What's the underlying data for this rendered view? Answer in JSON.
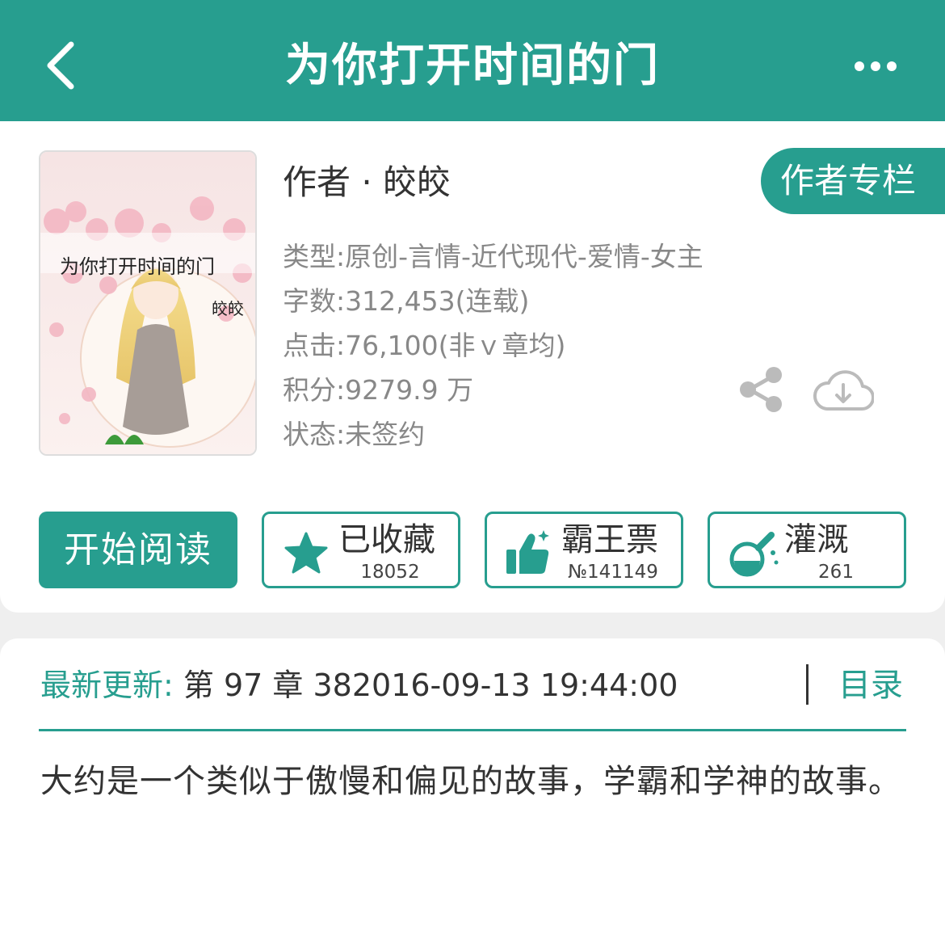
{
  "header": {
    "title": "为你打开时间的门",
    "back_icon": "chevron-left-icon",
    "more_icon": "more-horizontal-icon",
    "bg_color": "#279e8f"
  },
  "book": {
    "cover": {
      "title": "为你打开时间的门",
      "author": "皎皎"
    },
    "author_line": "作者 · 皎皎",
    "author_column_label": "作者专栏",
    "meta": {
      "type": "类型:原创-言情-近代现代-爱情-女主",
      "words": "字数:312,453(连载)",
      "clicks": "点击:76,100(非ｖ章均)",
      "score": "积分:9279.9 万",
      "status": "状态:未签约"
    },
    "share_icon": "share-icon",
    "download_icon": "cloud-download-icon"
  },
  "actions": {
    "start_reading": "开始阅读",
    "collect": {
      "label": "已收藏",
      "count": "18052",
      "icon": "star-icon"
    },
    "vote": {
      "label": "霸王票",
      "count": "№141149",
      "icon": "thumbs-up-icon"
    },
    "water": {
      "label": "灌溉",
      "count": "261",
      "icon": "flask-icon"
    }
  },
  "latest": {
    "label": "最新更新:",
    "value": "第 97 章 382016-09-13 19:44:00",
    "toc_label": "目录"
  },
  "summary": "大约是一个类似于傲慢和偏见的故事，学霸和学神的故事。",
  "colors": {
    "accent": "#279e8f",
    "meta_text": "#888888",
    "body_text": "#333333"
  }
}
